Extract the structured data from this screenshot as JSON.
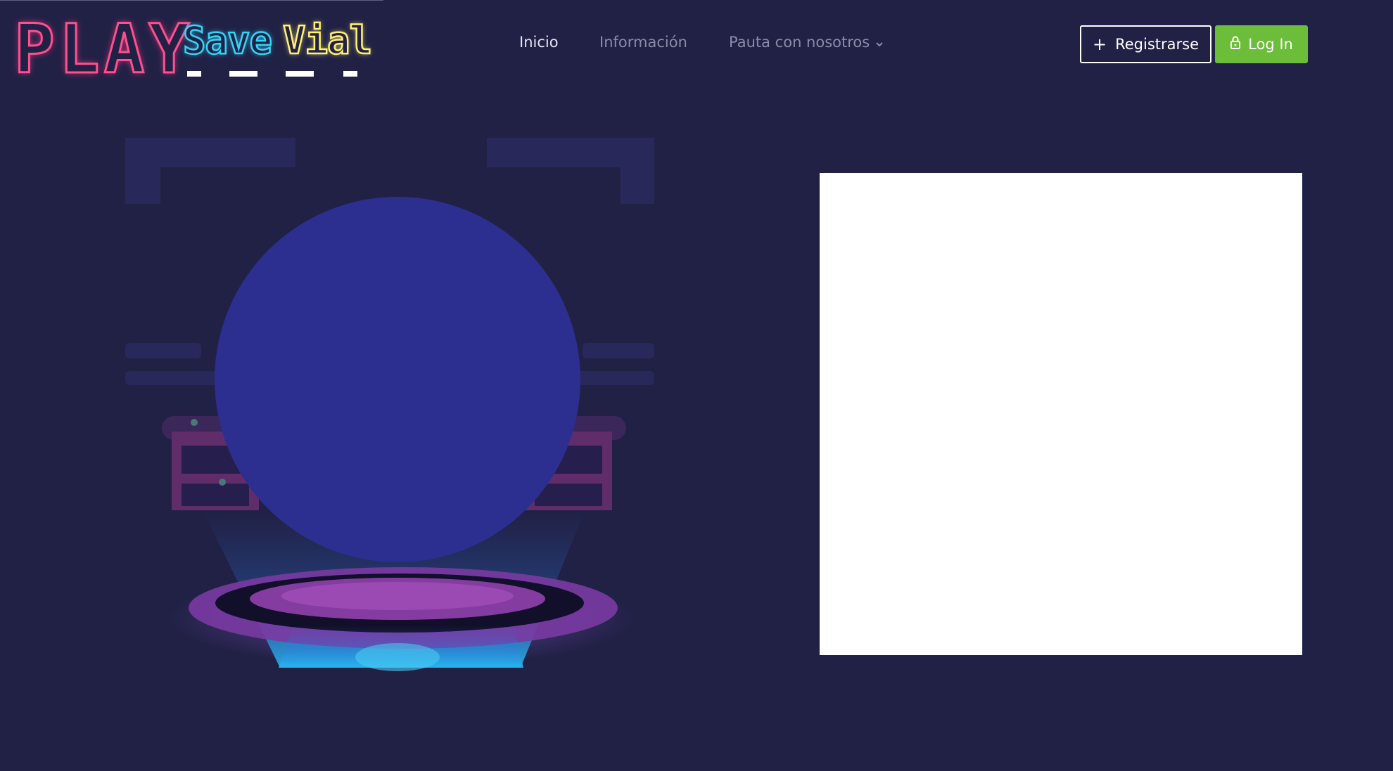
{
  "header": {
    "logo": {
      "play_text": "PLAY",
      "save_text": "Save",
      "vial_text": "Vial"
    },
    "nav": [
      {
        "label": "Inicio",
        "active": true
      },
      {
        "label": "Información",
        "active": false
      },
      {
        "label": "Pauta con nosotros",
        "active": false,
        "has_dropdown": true
      }
    ],
    "register_label": "Registrarse",
    "login_label": "Log In"
  },
  "hero": {
    "illustration": "neon-stage-hologram-illustration"
  },
  "colors": {
    "background": "#212146",
    "play_neon": "#ff4f8f",
    "save_neon": "#33d4f5",
    "vial_neon": "#fff172",
    "login_button": "#6bbd3a",
    "nav_active": "#e6e6f0",
    "nav_inactive": "#8b8ca9"
  },
  "icons": {
    "register": "plus-icon",
    "login": "lock-icon",
    "dropdown": "chevron-down-icon"
  }
}
